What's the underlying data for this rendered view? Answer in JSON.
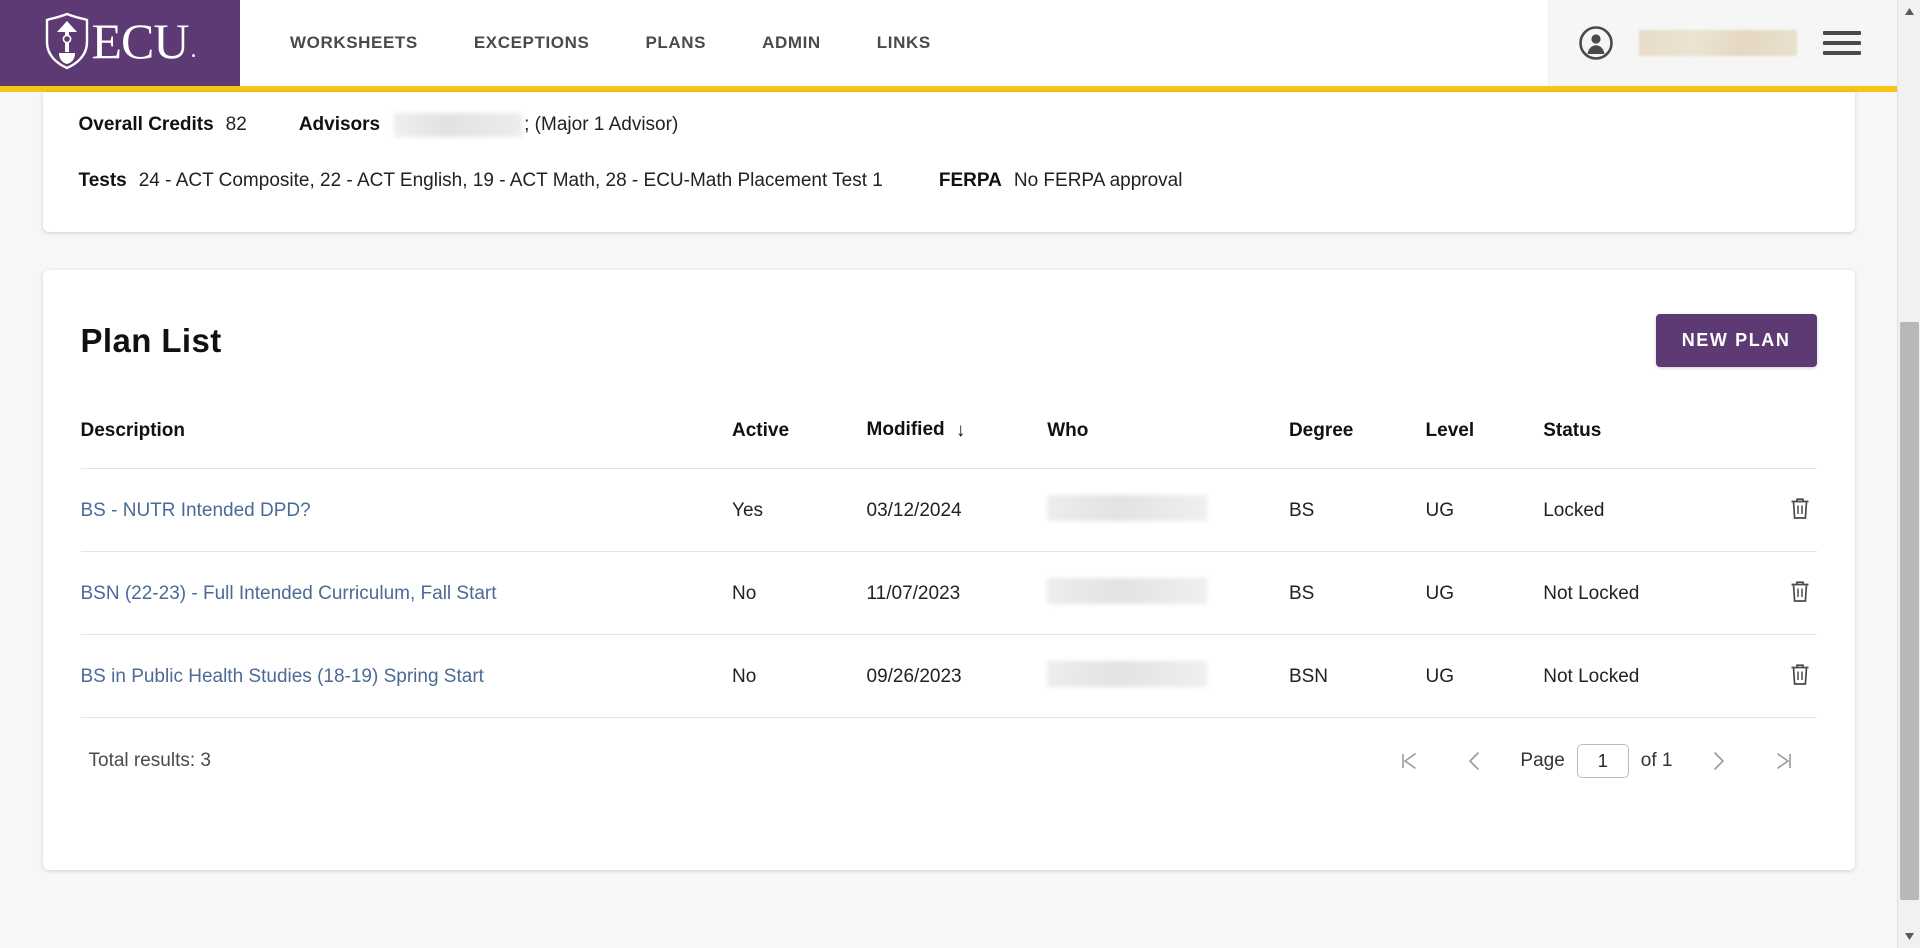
{
  "header": {
    "logo_text": "ECU",
    "logo_alt": "ecu-shield-logo",
    "nav": [
      {
        "label": "WORKSHEETS",
        "name": "nav-worksheets"
      },
      {
        "label": "EXCEPTIONS",
        "name": "nav-exceptions"
      },
      {
        "label": "PLANS",
        "name": "nav-plans"
      },
      {
        "label": "ADMIN",
        "name": "nav-admin"
      },
      {
        "label": "LINKS",
        "name": "nav-links"
      }
    ],
    "user_name": "",
    "avatar_icon": "user-avatar-icon",
    "menu_icon": "hamburger-menu-icon",
    "accent_purple": "#5d3a74",
    "accent_gold": "#f5c518"
  },
  "student_info": {
    "overall_credits_label": "Overall Credits",
    "overall_credits_value": "82",
    "advisors_label": "Advisors",
    "advisors_name": "",
    "advisors_suffix": "; (Major 1 Advisor)",
    "tests_label": "Tests",
    "tests_value": "24 - ACT Composite, 22 - ACT English, 19 - ACT Math, 28 - ECU-Math Placement Test 1",
    "ferpa_label": "FERPA",
    "ferpa_value": "No FERPA approval"
  },
  "plan_list": {
    "title": "Plan List",
    "new_plan_label": "NEW PLAN",
    "columns": {
      "description": "Description",
      "active": "Active",
      "modified": "Modified",
      "modified_sort": "↓",
      "who": "Who",
      "degree": "Degree",
      "level": "Level",
      "status": "Status"
    },
    "rows": [
      {
        "description": "BS - NUTR Intended DPD?",
        "active": "Yes",
        "modified": "03/12/2024",
        "who": "",
        "degree": "BS",
        "level": "UG",
        "status": "Locked"
      },
      {
        "description": "BSN (22-23) - Full Intended Curriculum, Fall Start",
        "active": "No",
        "modified": "11/07/2023",
        "who": "",
        "degree": "BS",
        "level": "UG",
        "status": "Not Locked"
      },
      {
        "description": "BS in Public Health Studies (18-19) Spring Start",
        "active": "No",
        "modified": "09/26/2023",
        "who": "",
        "degree": "BSN",
        "level": "UG",
        "status": "Not Locked"
      }
    ],
    "delete_icon": "trash-icon",
    "footer": {
      "total_results": "Total results: 3",
      "first_icon": "first-page-icon",
      "prev_icon": "previous-page-icon",
      "page_label": "Page",
      "page_value": "1",
      "of_label": "of 1",
      "next_icon": "next-page-icon",
      "last_icon": "last-page-icon"
    }
  }
}
